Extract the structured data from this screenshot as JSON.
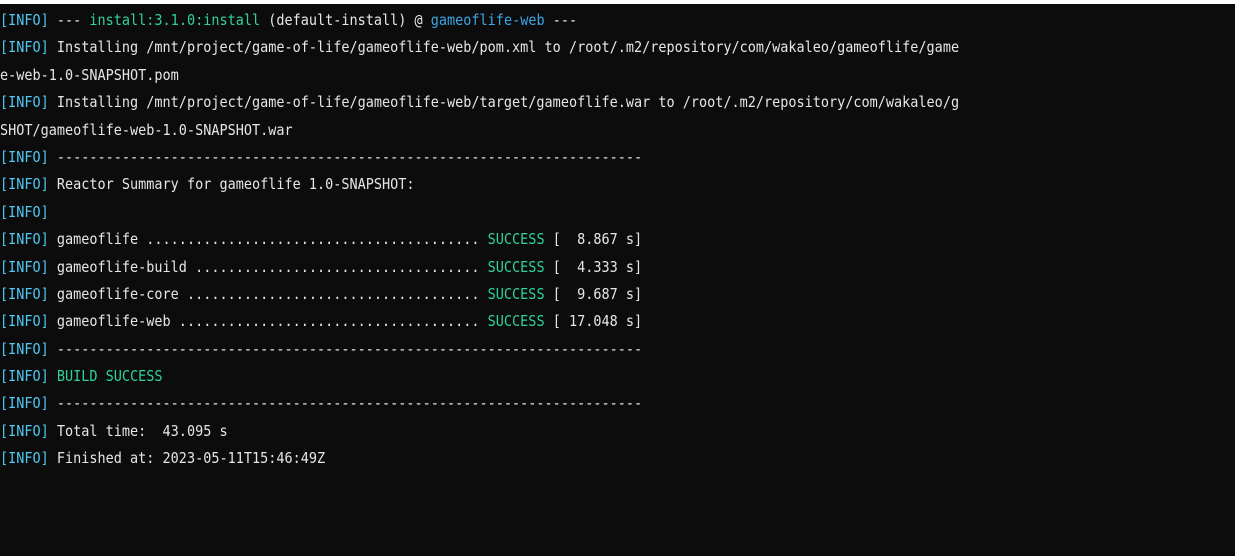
{
  "terminal": {
    "colors": {
      "background": "#0c0c0c",
      "text": "#e6e6e6",
      "info_tag": "#4ec9f2",
      "success": "#2fd39a",
      "artifact": "#3aa7e6"
    },
    "lines": [
      {
        "tag": "[INFO]",
        "parts": [
          {
            "t": " --- ",
            "c": ""
          },
          {
            "t": "install:3.1.0:install",
            "c": "green"
          },
          {
            "t": " (default-install) @ ",
            "c": ""
          },
          {
            "t": "gameoflife-web",
            "c": "cyan"
          },
          {
            "t": " ---",
            "c": ""
          }
        ]
      },
      {
        "tag": "[INFO]",
        "parts": [
          {
            "t": " Installing /mnt/project/game-of-life/gameoflife-web/pom.xml to /root/.m2/repository/com/wakaleo/gameoflife/game",
            "c": ""
          }
        ]
      },
      {
        "tag": "",
        "parts": [
          {
            "t": "e-web-1.0-SNAPSHOT.pom",
            "c": ""
          }
        ]
      },
      {
        "tag": "[INFO]",
        "parts": [
          {
            "t": " Installing /mnt/project/game-of-life/gameoflife-web/target/gameoflife.war to /root/.m2/repository/com/wakaleo/g",
            "c": ""
          }
        ]
      },
      {
        "tag": "",
        "parts": [
          {
            "t": "SHOT/gameoflife-web-1.0-SNAPSHOT.war",
            "c": ""
          }
        ]
      },
      {
        "tag": "[INFO]",
        "parts": [
          {
            "t": " ------------------------------------------------------------------------",
            "c": ""
          }
        ]
      },
      {
        "tag": "[INFO]",
        "parts": [
          {
            "t": " Reactor Summary for gameoflife 1.0-SNAPSHOT:",
            "c": ""
          }
        ]
      },
      {
        "tag": "[INFO]",
        "parts": []
      },
      {
        "tag": "[INFO]",
        "parts": [
          {
            "t": " gameoflife ......................................... ",
            "c": ""
          },
          {
            "t": "SUCCESS",
            "c": "green"
          },
          {
            "t": " [  8.867 s]",
            "c": ""
          }
        ]
      },
      {
        "tag": "[INFO]",
        "parts": [
          {
            "t": " gameoflife-build ................................... ",
            "c": ""
          },
          {
            "t": "SUCCESS",
            "c": "green"
          },
          {
            "t": " [  4.333 s]",
            "c": ""
          }
        ]
      },
      {
        "tag": "[INFO]",
        "parts": [
          {
            "t": " gameoflife-core .................................... ",
            "c": ""
          },
          {
            "t": "SUCCESS",
            "c": "green"
          },
          {
            "t": " [  9.687 s]",
            "c": ""
          }
        ]
      },
      {
        "tag": "[INFO]",
        "parts": [
          {
            "t": " gameoflife-web ..................................... ",
            "c": ""
          },
          {
            "t": "SUCCESS",
            "c": "green"
          },
          {
            "t": " [ 17.048 s]",
            "c": ""
          }
        ]
      },
      {
        "tag": "[INFO]",
        "parts": [
          {
            "t": " ------------------------------------------------------------------------",
            "c": ""
          }
        ]
      },
      {
        "tag": "[INFO]",
        "parts": [
          {
            "t": " ",
            "c": ""
          },
          {
            "t": "BUILD SUCCESS",
            "c": "green"
          }
        ]
      },
      {
        "tag": "[INFO]",
        "parts": [
          {
            "t": " ------------------------------------------------------------------------",
            "c": ""
          }
        ]
      },
      {
        "tag": "[INFO]",
        "parts": [
          {
            "t": " Total time:  43.095 s",
            "c": ""
          }
        ]
      },
      {
        "tag": "[INFO]",
        "parts": [
          {
            "t": " Finished at: 2023-05-11T15:46:49Z",
            "c": ""
          }
        ]
      }
    ]
  }
}
